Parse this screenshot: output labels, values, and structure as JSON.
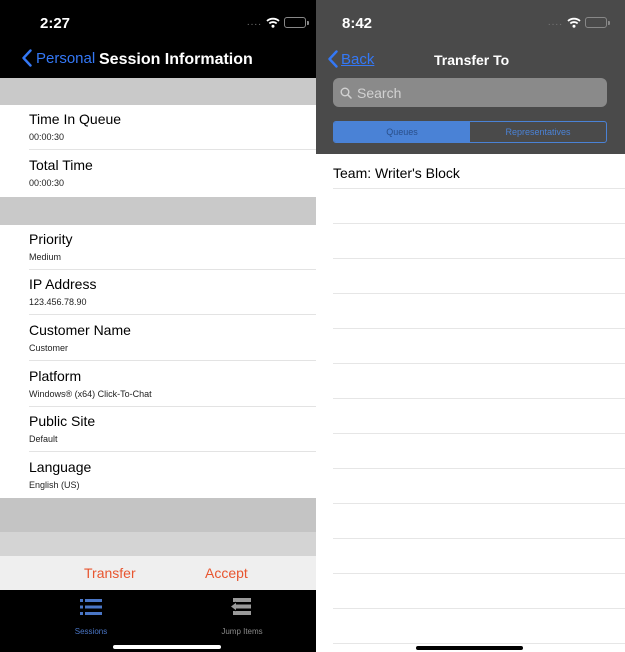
{
  "left_screen": {
    "status": {
      "time": "2:27",
      "dots": "....",
      "wifi_icon": "wifi-icon",
      "battery_icon": "battery-icon"
    },
    "nav": {
      "back_label": "Personal",
      "title": "Session Information"
    },
    "details": [
      {
        "label": "Time In Queue",
        "value": "00:00:30"
      },
      {
        "label": "Total Time",
        "value": "00:00:30"
      },
      {
        "label": "Priority",
        "value": "Medium"
      },
      {
        "label": "IP Address",
        "value": "123.456.78.90"
      },
      {
        "label": "Customer Name",
        "value": "Customer"
      },
      {
        "label": "Platform",
        "value": "Windows® (x64) Click-To-Chat"
      },
      {
        "label": "Public Site",
        "value": "Default"
      },
      {
        "label": "Language",
        "value": "English (US)"
      }
    ],
    "actions": {
      "transfer_label": "Transfer",
      "accept_label": "Accept",
      "color": "#e8552f"
    },
    "tabbar": {
      "items": [
        {
          "label": "Sessions",
          "icon": "list-icon",
          "selected": true
        },
        {
          "label": "Jump Items",
          "icon": "jump-items-icon",
          "selected": false
        }
      ]
    }
  },
  "right_screen": {
    "status": {
      "time": "8:42",
      "dots": "....",
      "wifi_icon": "wifi-icon",
      "battery_icon": "battery-icon"
    },
    "nav": {
      "back_label": "Back",
      "title": "Transfer To"
    },
    "search": {
      "placeholder": "Search",
      "value": ""
    },
    "segments": [
      {
        "label": "Queues",
        "selected": true
      },
      {
        "label": "Representatives",
        "selected": false
      }
    ],
    "rows": [
      {
        "text": "Team: Writer's Block"
      },
      {
        "text": ""
      },
      {
        "text": ""
      },
      {
        "text": ""
      },
      {
        "text": ""
      },
      {
        "text": ""
      },
      {
        "text": ""
      },
      {
        "text": ""
      },
      {
        "text": ""
      },
      {
        "text": ""
      },
      {
        "text": ""
      },
      {
        "text": ""
      },
      {
        "text": ""
      },
      {
        "text": ""
      }
    ]
  },
  "colors": {
    "accent_blue": "#3478f6",
    "segment_blue": "#4a82d6",
    "action_orange": "#e8552f",
    "battery_green": "#35c759"
  }
}
